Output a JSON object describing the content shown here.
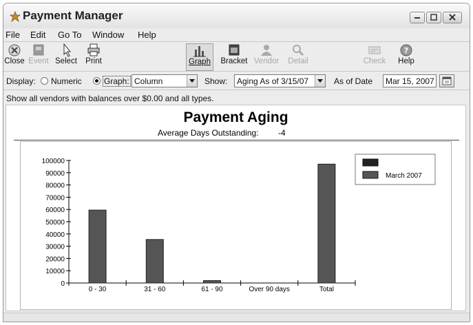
{
  "window": {
    "title": "Payment Manager"
  },
  "menu": [
    "File",
    "Edit",
    "Go To",
    "Window",
    "Help"
  ],
  "toolbar": {
    "close": "Close",
    "event": "Event",
    "select": "Select",
    "print": "Print",
    "graph": "Graph",
    "bracket": "Bracket",
    "vendor": "Vendor",
    "detail": "Detail",
    "check": "Check",
    "help": "Help"
  },
  "options": {
    "display_label": "Display:",
    "numeric_label": "Numeric",
    "graph_label": "Graph:",
    "display_mode": "Graph",
    "graph_type": "Column",
    "show_label": "Show:",
    "show_value": "Aging As of 3/15/07",
    "asof_label": "As of Date",
    "asof_value": "Mar 15, 2007"
  },
  "filter_text": "Show all vendors with balances over $0.00 and all types.",
  "report": {
    "title": "Payment Aging",
    "subtitle_label": "Average Days Outstanding:",
    "subtitle_value": "-4"
  },
  "colors": {
    "bar": "#555555",
    "legend_blank": "#222222"
  },
  "chart_data": {
    "type": "bar",
    "categories": [
      "0 - 30",
      "31 - 60",
      "61 - 90",
      "Over 90 days",
      "Total"
    ],
    "series": [
      {
        "name": "",
        "values": [
          0,
          0,
          0,
          0,
          0
        ]
      },
      {
        "name": "March 2007",
        "values": [
          59500,
          35500,
          2000,
          0,
          97000
        ]
      }
    ],
    "ylim": [
      0,
      100000
    ],
    "yticks": [
      0,
      10000,
      20000,
      30000,
      40000,
      50000,
      60000,
      70000,
      80000,
      90000,
      100000
    ],
    "legend": "top-right",
    "grid": false
  }
}
